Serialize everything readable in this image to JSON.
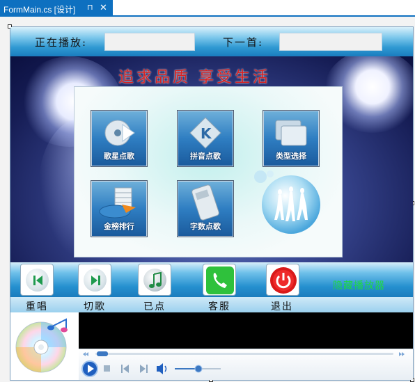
{
  "tab": {
    "title": "FormMain.cs [设计]",
    "pin": "⊓",
    "close": "✕"
  },
  "header": {
    "now_playing_label": "正在播放:",
    "now_playing_value": "",
    "next_label": "下一首:",
    "next_value": ""
  },
  "slogan": "追求品质  享受生活",
  "menu": [
    {
      "label": "歌星点歌",
      "icon": "singer-disc-icon"
    },
    {
      "label": "拼音点歌",
      "icon": "pinyin-k-icon"
    },
    {
      "label": "类型选择",
      "icon": "category-windows-icon"
    },
    {
      "label": "金榜排行",
      "icon": "chart-ranking-icon"
    },
    {
      "label": "字数点歌",
      "icon": "phone-keypad-icon"
    }
  ],
  "controls": [
    {
      "label": "重唱",
      "icon": "replay-icon"
    },
    {
      "label": "切歌",
      "icon": "skip-icon"
    },
    {
      "label": "已点",
      "icon": "music-note-icon"
    },
    {
      "label": "客服",
      "icon": "phone-icon"
    },
    {
      "label": "退出",
      "icon": "power-icon"
    }
  ],
  "hide_player": "隐藏播放器",
  "colors": {
    "accent": "#0e70c0",
    "slogan": "#d62222",
    "hide_player": "#1ed940"
  }
}
